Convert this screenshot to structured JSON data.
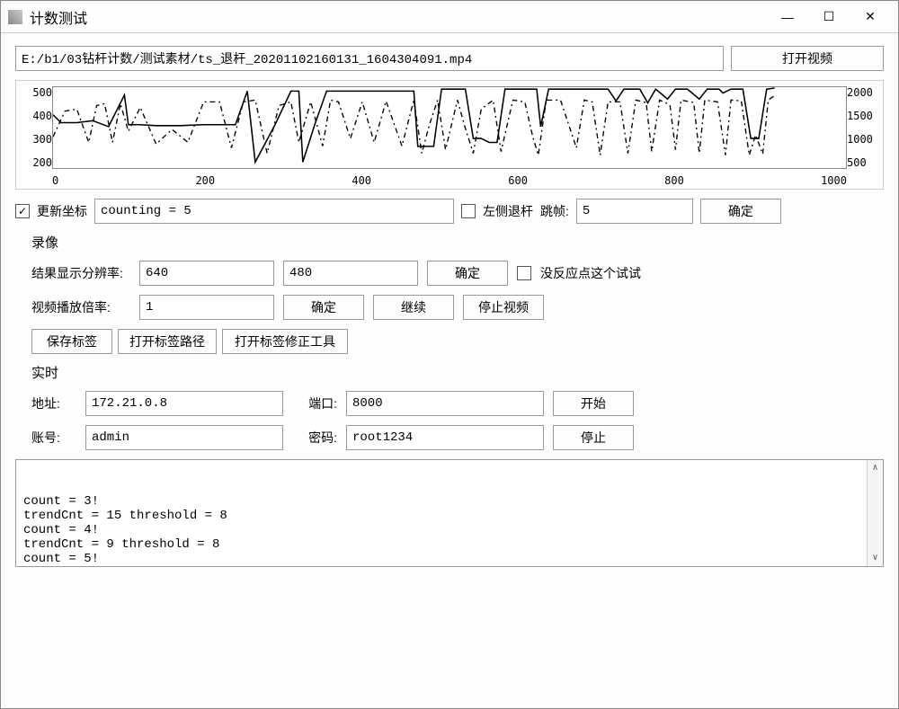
{
  "window": {
    "title": "计数测试",
    "minimize": "—",
    "maximize": "☐",
    "close": "✕"
  },
  "file": {
    "path": "E:/b1/03钻杆计数/测试素材/ts_退杆_20201102160131_1604304091.mp4",
    "open_button": "打开视频"
  },
  "chart_data": {
    "type": "line",
    "left_axis_ticks": [
      "500",
      "400",
      "300",
      "200"
    ],
    "right_axis_ticks": [
      "2000",
      "1500",
      "1000",
      "500"
    ],
    "x_ticks": [
      "0",
      "200",
      "400",
      "600",
      "800",
      "1000"
    ],
    "xrange": [
      0,
      1000
    ],
    "left_yrange": [
      150,
      560
    ],
    "right_yrange": [
      0,
      2200
    ],
    "series": [
      {
        "name": "series-solid",
        "axis": "left",
        "style": "solid",
        "values": [
          [
            0,
            420
          ],
          [
            10,
            380
          ],
          [
            30,
            380
          ],
          [
            50,
            390
          ],
          [
            70,
            360
          ],
          [
            90,
            520
          ],
          [
            95,
            370
          ],
          [
            110,
            370
          ],
          [
            130,
            365
          ],
          [
            160,
            365
          ],
          [
            190,
            370
          ],
          [
            210,
            370
          ],
          [
            230,
            370
          ],
          [
            245,
            540
          ],
          [
            255,
            180
          ],
          [
            280,
            370
          ],
          [
            300,
            540
          ],
          [
            310,
            540
          ],
          [
            315,
            180
          ],
          [
            330,
            370
          ],
          [
            345,
            540
          ],
          [
            360,
            540
          ],
          [
            380,
            540
          ],
          [
            400,
            540
          ],
          [
            420,
            540
          ],
          [
            440,
            540
          ],
          [
            455,
            540
          ],
          [
            460,
            260
          ],
          [
            470,
            260
          ],
          [
            480,
            260
          ],
          [
            490,
            550
          ],
          [
            500,
            550
          ],
          [
            520,
            550
          ],
          [
            530,
            300
          ],
          [
            540,
            300
          ],
          [
            550,
            280
          ],
          [
            560,
            280
          ],
          [
            570,
            550
          ],
          [
            590,
            550
          ],
          [
            610,
            550
          ],
          [
            615,
            360
          ],
          [
            625,
            550
          ],
          [
            640,
            550
          ],
          [
            660,
            550
          ],
          [
            680,
            550
          ],
          [
            700,
            550
          ],
          [
            710,
            490
          ],
          [
            720,
            550
          ],
          [
            740,
            550
          ],
          [
            750,
            480
          ],
          [
            760,
            550
          ],
          [
            775,
            500
          ],
          [
            785,
            550
          ],
          [
            800,
            550
          ],
          [
            815,
            500
          ],
          [
            825,
            550
          ],
          [
            840,
            550
          ],
          [
            845,
            530
          ],
          [
            855,
            550
          ],
          [
            870,
            550
          ],
          [
            880,
            300
          ],
          [
            890,
            300
          ],
          [
            900,
            550
          ],
          [
            910,
            555
          ]
        ]
      },
      {
        "name": "series-dashed",
        "axis": "right",
        "style": "dash",
        "values": [
          [
            0,
            850
          ],
          [
            15,
            1550
          ],
          [
            30,
            1600
          ],
          [
            45,
            700
          ],
          [
            55,
            1700
          ],
          [
            65,
            1750
          ],
          [
            75,
            700
          ],
          [
            85,
            1750
          ],
          [
            95,
            1000
          ],
          [
            110,
            1650
          ],
          [
            130,
            650
          ],
          [
            150,
            1050
          ],
          [
            170,
            700
          ],
          [
            190,
            1800
          ],
          [
            210,
            1800
          ],
          [
            225,
            550
          ],
          [
            240,
            1800
          ],
          [
            255,
            1850
          ],
          [
            270,
            400
          ],
          [
            285,
            1700
          ],
          [
            300,
            1800
          ],
          [
            310,
            700
          ],
          [
            325,
            1800
          ],
          [
            340,
            600
          ],
          [
            350,
            1850
          ],
          [
            360,
            1800
          ],
          [
            375,
            800
          ],
          [
            390,
            1800
          ],
          [
            405,
            700
          ],
          [
            420,
            1820
          ],
          [
            440,
            600
          ],
          [
            455,
            1850
          ],
          [
            465,
            400
          ],
          [
            475,
            1200
          ],
          [
            485,
            1850
          ],
          [
            495,
            500
          ],
          [
            510,
            1850
          ],
          [
            520,
            1080
          ],
          [
            530,
            400
          ],
          [
            540,
            1600
          ],
          [
            555,
            1850
          ],
          [
            565,
            450
          ],
          [
            580,
            1850
          ],
          [
            595,
            1800
          ],
          [
            605,
            850
          ],
          [
            612,
            350
          ],
          [
            622,
            1850
          ],
          [
            640,
            1850
          ],
          [
            660,
            550
          ],
          [
            670,
            1850
          ],
          [
            680,
            1800
          ],
          [
            690,
            350
          ],
          [
            700,
            1800
          ],
          [
            715,
            1800
          ],
          [
            725,
            400
          ],
          [
            735,
            1850
          ],
          [
            748,
            1780
          ],
          [
            755,
            450
          ],
          [
            765,
            1850
          ],
          [
            778,
            1720
          ],
          [
            785,
            500
          ],
          [
            792,
            1850
          ],
          [
            808,
            1780
          ],
          [
            815,
            400
          ],
          [
            822,
            1850
          ],
          [
            838,
            1800
          ],
          [
            848,
            350
          ],
          [
            855,
            1850
          ],
          [
            868,
            1830
          ],
          [
            878,
            350
          ],
          [
            886,
            900
          ],
          [
            895,
            380
          ],
          [
            902,
            1850
          ],
          [
            912,
            2000
          ]
        ]
      }
    ]
  },
  "options_row": {
    "update_coords_label": "更新坐标",
    "counting_value": "counting = 5",
    "left_retreat_label": "左侧退杆",
    "skip_frame_label": "跳帧:",
    "skip_frame_value": "5",
    "confirm": "确定"
  },
  "recording": {
    "section": "录像",
    "resolution_label": "结果显示分辨率:",
    "res_w": "640",
    "res_h": "480",
    "confirm": "确定",
    "no_response_label": "没反应点这个试试",
    "play_rate_label": "视频播放倍率:",
    "play_rate": "1",
    "confirm2": "确定",
    "continue": "继续",
    "stop_video": "停止视频",
    "save_label": "保存标签",
    "open_label_path": "打开标签路径",
    "open_fix_tool": "打开标签修正工具"
  },
  "realtime": {
    "section": "实时",
    "addr_label": "地址:",
    "addr": "172.21.0.8",
    "port_label": "端口:",
    "port": "8000",
    "start": "开始",
    "acct_label": "账号:",
    "acct": "admin",
    "pwd_label": "密码:",
    "pwd": "root1234",
    "stop": "停止"
  },
  "log": {
    "lines": [
      "count = 3!",
      "trendCnt = 15 threshold = 8",
      "count = 4!",
      "trendCnt = 9 threshold = 8",
      "count = 5!"
    ]
  }
}
